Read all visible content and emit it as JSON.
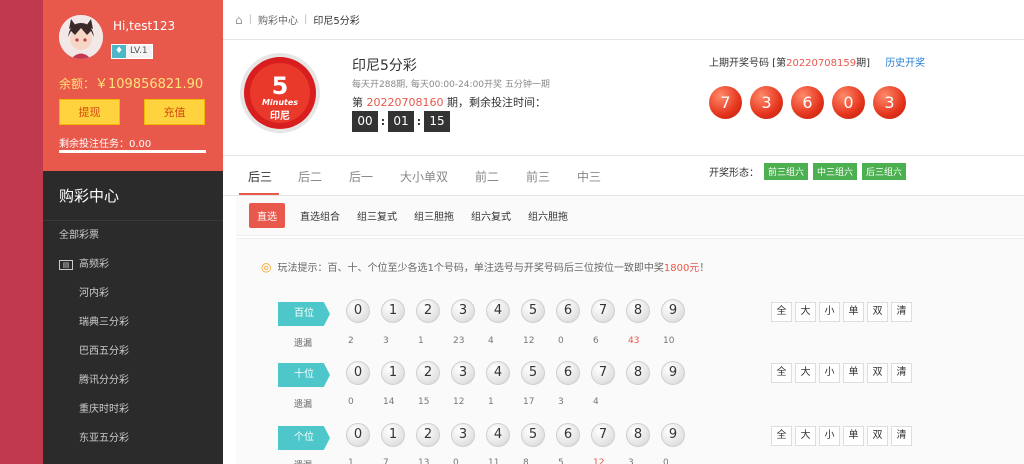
{
  "user": {
    "name": "Hi,test123",
    "level": "LV.1",
    "balance_label": "余额：",
    "balance": "￥109856821.90",
    "withdraw": "提现",
    "recharge": "充值",
    "task": "剩余投注任务：0.00"
  },
  "sidebar": {
    "title": "购彩中心",
    "all": "全部彩票",
    "group": "高频彩",
    "items": [
      "河内彩",
      "瑞典三分彩",
      "巴西五分彩",
      "腾讯分分彩",
      "重庆时时彩",
      "东亚五分彩"
    ]
  },
  "breadcrumb": {
    "section": "购彩中心",
    "current": "印尼5分彩"
  },
  "game": {
    "name": "印尼5分彩",
    "logo_top": "5",
    "logo_mid": "Minutes",
    "logo_bottom": "印尼",
    "desc": "每天开288期, 每天00:00-24:00开奖 五分钟一期",
    "issue_prefix": "第",
    "issue": "20220708160",
    "issue_suffix": "期，剩余投注时间：",
    "timer": [
      "00",
      "01",
      "15"
    ]
  },
  "last_draw": {
    "label": "上期开奖号码 [第",
    "issue": "20220708159",
    "suffix": "期]",
    "history": "历史开奖",
    "balls": [
      "7",
      "3",
      "6",
      "0",
      "3"
    ],
    "shape_label": "开奖形态：",
    "shapes": [
      "前三组六",
      "中三组六",
      "后三组六"
    ]
  },
  "tabs": [
    "后三",
    "后二",
    "后一",
    "大小单双",
    "前二",
    "前三",
    "中三"
  ],
  "subtabs": [
    "直选",
    "直选组合",
    "组三复式",
    "组三胆拖",
    "组六复式",
    "组六胆拖"
  ],
  "tip": {
    "prefix": "玩法提示：百、十、个位至少各选1个号码，单注选号与开奖号码后三位按位一致即中奖",
    "prize": "1800元",
    "suffix": "！"
  },
  "rows": [
    {
      "label": "百位",
      "miss": [
        "2",
        "3",
        "1",
        "23",
        "4",
        "12",
        "0",
        "6",
        "43",
        "10"
      ],
      "hot": [
        8
      ]
    },
    {
      "label": "十位",
      "miss": [
        "0",
        "14",
        "15",
        "12",
        "1",
        "17",
        "3",
        "4",
        "",
        ""
      ],
      "hot": []
    },
    {
      "label": "个位",
      "miss": [
        "1",
        "7",
        "13",
        "0",
        "11",
        "8",
        "5",
        "12",
        "3",
        "0"
      ],
      "hot": [
        7
      ]
    }
  ],
  "miss_label": "遗漏",
  "digits": [
    "0",
    "1",
    "2",
    "3",
    "4",
    "5",
    "6",
    "7",
    "8",
    "9"
  ],
  "quick": [
    "全",
    "大",
    "小",
    "单",
    "双",
    "清"
  ],
  "colors": {
    "accent": "#e8584b",
    "strip": "#c0394d",
    "sidebar": "#2b2b2b",
    "teal": "#4dc7c9",
    "green": "#4caf50"
  }
}
